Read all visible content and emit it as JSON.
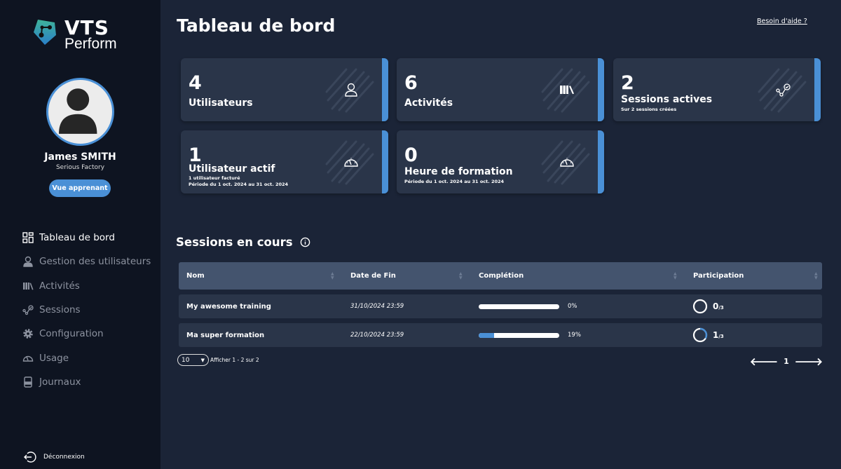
{
  "brand": {
    "name_line1": "VTS",
    "name_line2": "Perform"
  },
  "user": {
    "name": "James SMITH",
    "company": "Serious Factory",
    "learner_view_label": "Vue apprenant"
  },
  "sidebar": {
    "items": [
      {
        "label": "Tableau de bord",
        "icon": "dashboard-icon",
        "active": true
      },
      {
        "label": "Gestion des utilisateurs",
        "icon": "user-icon"
      },
      {
        "label": "Activités",
        "icon": "library-icon"
      },
      {
        "label": "Sessions",
        "icon": "route-check-icon"
      },
      {
        "label": "Configuration",
        "icon": "gear-icon"
      },
      {
        "label": "Usage",
        "icon": "gauge-icon"
      },
      {
        "label": "Journaux",
        "icon": "log-icon"
      }
    ],
    "logout_label": "Déconnexion"
  },
  "header": {
    "title": "Tableau de bord",
    "help_link": "Besoin d'aide ?"
  },
  "stats": [
    {
      "value": "4",
      "label": "Utilisateurs",
      "icon": "user-icon"
    },
    {
      "value": "6",
      "label": "Activités",
      "icon": "library-icon"
    },
    {
      "value": "2",
      "label": "Sessions actives",
      "sub1": "Sur 2 sessions créées",
      "icon": "route-check-icon"
    },
    {
      "value": "1",
      "label": "Utilisateur actif",
      "sub1": "1 utilisateur facturé",
      "sub2": "Période du 1 oct. 2024 au 31 oct. 2024",
      "icon": "gauge-icon"
    },
    {
      "value": "0",
      "label": "Heure de formation",
      "sub1": "Période du 1 oct. 2024 au 31 oct. 2024",
      "icon": "gauge-icon"
    }
  ],
  "sessions": {
    "title": "Sessions en cours",
    "columns": [
      "Nom",
      "Date de Fin",
      "Complétion",
      "Participation"
    ],
    "rows": [
      {
        "name": "My awesome training",
        "end": "31/10/2024 23:59",
        "completion": 0,
        "completion_label": "0%",
        "participants": "0",
        "total": "/3"
      },
      {
        "name": "Ma super formation",
        "end": "22/10/2024 23:59",
        "completion": 19,
        "completion_label": "19%",
        "participants": "1",
        "total": "/3"
      }
    ],
    "page_size": "10",
    "showing": "Afficher 1 - 2 sur 2",
    "current_page": "1"
  },
  "colors": {
    "accent": "#4a90d6",
    "sidebar": "#0e1421",
    "background": "#1b2437",
    "card": "#2a3549"
  }
}
